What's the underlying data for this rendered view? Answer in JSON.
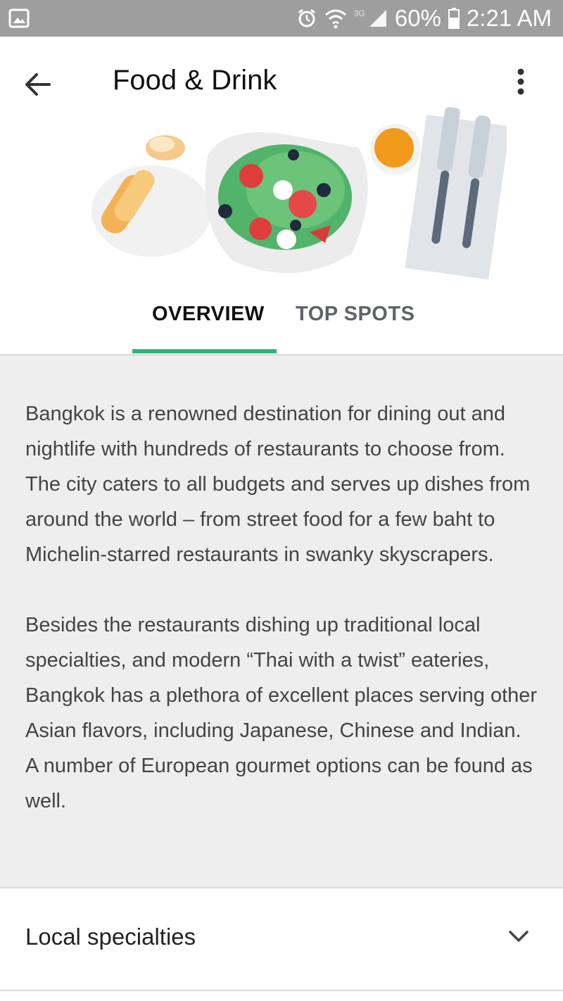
{
  "status_bar": {
    "battery": "60%",
    "time": "2:21 AM",
    "network_label": "3G",
    "icons": [
      "gallery-icon",
      "alarm-icon",
      "wifi-icon",
      "signal-icon",
      "battery-icon"
    ]
  },
  "app_bar": {
    "title": "Food & Drink",
    "icons": [
      "back-arrow-icon",
      "more-vert-icon"
    ]
  },
  "tabs": [
    {
      "label": "OVERVIEW",
      "active": true
    },
    {
      "label": "TOP SPOTS",
      "active": false
    }
  ],
  "overview": {
    "paragraphs": [
      "Bangkok is a renowned destination for dining out and nightlife with hundreds of restaurants to choose from. The city caters to all budgets and serves up dishes from around the world – from street food for a few baht to Michelin-starred restaurants in swanky skyscrapers.",
      "Besides the restaurants dishing up traditional local specialties, and modern “Thai with a twist” eateries, Bangkok has a plethora of excellent places serving other Asian flavors, including Japanese, Chinese and Indian. A number of European gourmet options can be found as well."
    ]
  },
  "sections": [
    {
      "label": "Local specialties",
      "icon": "chevron-down-icon"
    }
  ],
  "colors": {
    "accent": "#2fb37a",
    "status_bar": "#9e9e9e",
    "content_bg": "#eeeeee"
  }
}
